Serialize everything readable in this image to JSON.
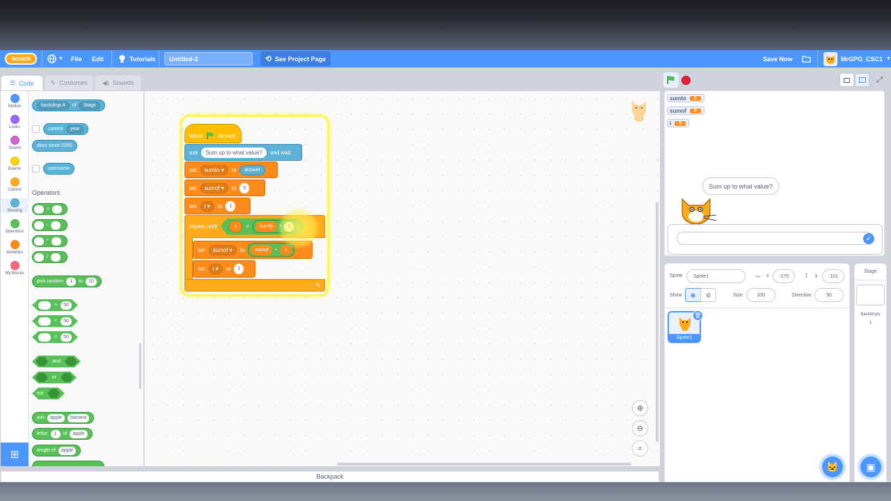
{
  "menubar": {
    "logo": "Scratch",
    "file": "File",
    "edit": "Edit",
    "tutorials": "Tutorials",
    "project_title": "Untitled-2",
    "see_project": "See Project Page",
    "save_now": "Save Now",
    "username": "MrGPG_CSC1"
  },
  "tabs": {
    "code": "Code",
    "costumes": "Costumes",
    "sounds": "Sounds"
  },
  "categories": [
    {
      "label": "Motion",
      "color": "#4c97ff"
    },
    {
      "label": "Looks",
      "color": "#9966ff"
    },
    {
      "label": "Sound",
      "color": "#cf63cf"
    },
    {
      "label": "Events",
      "color": "#ffd500"
    },
    {
      "label": "Control",
      "color": "#ffab19"
    },
    {
      "label": "Sensing",
      "color": "#5cb1d6"
    },
    {
      "label": "Operators",
      "color": "#59c059"
    },
    {
      "label": "Variables",
      "color": "#ff8c1a"
    },
    {
      "label": "My Blocks",
      "color": "#ff6680"
    }
  ],
  "palette": {
    "backdrop_of": {
      "dd1": "backdrop #",
      "of": "of",
      "dd2": "Stage"
    },
    "current": {
      "label": "current",
      "dd": "year"
    },
    "days_since": "days since 2000",
    "username": "username",
    "operators_heading": "Operators",
    "ops": [
      "+",
      "-",
      "*",
      "/"
    ],
    "pick_random": {
      "label": "pick random",
      "a": "1",
      "to": "to",
      "b": "10"
    },
    "compare": [
      {
        "op": ">",
        "v": "50"
      },
      {
        "op": "<",
        "v": "50"
      },
      {
        "op": "=",
        "v": "50"
      }
    ],
    "and": "and",
    "or": "or",
    "not": "not",
    "join": {
      "label": "join",
      "a": "apple",
      "b": "banana"
    },
    "letter": {
      "label": "letter",
      "n": "1",
      "of": "of",
      "s": "apple"
    },
    "length": {
      "label": "length of",
      "s": "apple"
    }
  },
  "script": {
    "when": "when",
    "clicked": "clicked",
    "ask": {
      "label": "ask",
      "text": "Sum up to what value?",
      "wait": "and wait"
    },
    "set1": {
      "label": "set",
      "var": "sumto",
      "to": "to",
      "val": "answer"
    },
    "set2": {
      "label": "set",
      "var": "sumof",
      "to": "to",
      "val": "0"
    },
    "set3": {
      "label": "set",
      "var": "i",
      "to": "to",
      "val": "1"
    },
    "repeat": {
      "label": "repeat until",
      "lhs": "i",
      "op": "=",
      "rhs": "sumto",
      "plus": "+",
      "one": "1"
    },
    "inner1": {
      "label": "set",
      "var": "sumof",
      "to": "to",
      "a": "sumof",
      "plus": "+",
      "b": "i"
    },
    "inner2": {
      "label": "set",
      "var": "i",
      "to": "to",
      "val": "1"
    }
  },
  "code_area": {
    "zoom_in": "+",
    "zoom_out": "−",
    "reset": "="
  },
  "backpack": "Backpack",
  "stage": {
    "monitors": [
      {
        "name": "sumto",
        "value": "0"
      },
      {
        "name": "sumof",
        "value": "0"
      },
      {
        "name": "i",
        "value": "0"
      }
    ],
    "bubble": "Sum up to what value?"
  },
  "sprite_info": {
    "sprite_label": "Sprite",
    "sprite_name": "Sprite1",
    "x_label": "x",
    "x": "-175",
    "y_label": "y",
    "y": "-101",
    "show": "Show",
    "size_label": "Size",
    "size": "100",
    "direction_label": "Direction",
    "direction": "90"
  },
  "sprites": [
    {
      "name": "Sprite1"
    }
  ],
  "stage_pane": {
    "title": "Stage",
    "backdrops_label": "Backdrops",
    "backdrops": "1"
  }
}
